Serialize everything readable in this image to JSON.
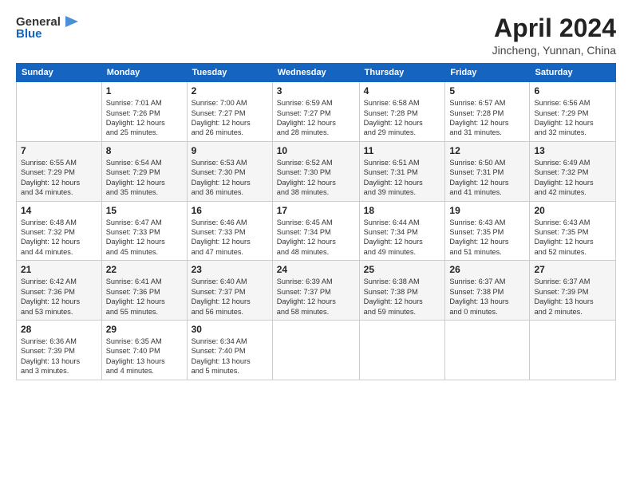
{
  "logo": {
    "general": "General",
    "blue": "Blue",
    "arrow": "▶"
  },
  "title": "April 2024",
  "subtitle": "Jincheng, Yunnan, China",
  "headers": [
    "Sunday",
    "Monday",
    "Tuesday",
    "Wednesday",
    "Thursday",
    "Friday",
    "Saturday"
  ],
  "weeks": [
    [
      {
        "day": "",
        "info": ""
      },
      {
        "day": "1",
        "info": "Sunrise: 7:01 AM\nSunset: 7:26 PM\nDaylight: 12 hours\nand 25 minutes."
      },
      {
        "day": "2",
        "info": "Sunrise: 7:00 AM\nSunset: 7:27 PM\nDaylight: 12 hours\nand 26 minutes."
      },
      {
        "day": "3",
        "info": "Sunrise: 6:59 AM\nSunset: 7:27 PM\nDaylight: 12 hours\nand 28 minutes."
      },
      {
        "day": "4",
        "info": "Sunrise: 6:58 AM\nSunset: 7:28 PM\nDaylight: 12 hours\nand 29 minutes."
      },
      {
        "day": "5",
        "info": "Sunrise: 6:57 AM\nSunset: 7:28 PM\nDaylight: 12 hours\nand 31 minutes."
      },
      {
        "day": "6",
        "info": "Sunrise: 6:56 AM\nSunset: 7:29 PM\nDaylight: 12 hours\nand 32 minutes."
      }
    ],
    [
      {
        "day": "7",
        "info": "Sunrise: 6:55 AM\nSunset: 7:29 PM\nDaylight: 12 hours\nand 34 minutes."
      },
      {
        "day": "8",
        "info": "Sunrise: 6:54 AM\nSunset: 7:29 PM\nDaylight: 12 hours\nand 35 minutes."
      },
      {
        "day": "9",
        "info": "Sunrise: 6:53 AM\nSunset: 7:30 PM\nDaylight: 12 hours\nand 36 minutes."
      },
      {
        "day": "10",
        "info": "Sunrise: 6:52 AM\nSunset: 7:30 PM\nDaylight: 12 hours\nand 38 minutes."
      },
      {
        "day": "11",
        "info": "Sunrise: 6:51 AM\nSunset: 7:31 PM\nDaylight: 12 hours\nand 39 minutes."
      },
      {
        "day": "12",
        "info": "Sunrise: 6:50 AM\nSunset: 7:31 PM\nDaylight: 12 hours\nand 41 minutes."
      },
      {
        "day": "13",
        "info": "Sunrise: 6:49 AM\nSunset: 7:32 PM\nDaylight: 12 hours\nand 42 minutes."
      }
    ],
    [
      {
        "day": "14",
        "info": "Sunrise: 6:48 AM\nSunset: 7:32 PM\nDaylight: 12 hours\nand 44 minutes."
      },
      {
        "day": "15",
        "info": "Sunrise: 6:47 AM\nSunset: 7:33 PM\nDaylight: 12 hours\nand 45 minutes."
      },
      {
        "day": "16",
        "info": "Sunrise: 6:46 AM\nSunset: 7:33 PM\nDaylight: 12 hours\nand 47 minutes."
      },
      {
        "day": "17",
        "info": "Sunrise: 6:45 AM\nSunset: 7:34 PM\nDaylight: 12 hours\nand 48 minutes."
      },
      {
        "day": "18",
        "info": "Sunrise: 6:44 AM\nSunset: 7:34 PM\nDaylight: 12 hours\nand 49 minutes."
      },
      {
        "day": "19",
        "info": "Sunrise: 6:43 AM\nSunset: 7:35 PM\nDaylight: 12 hours\nand 51 minutes."
      },
      {
        "day": "20",
        "info": "Sunrise: 6:43 AM\nSunset: 7:35 PM\nDaylight: 12 hours\nand 52 minutes."
      }
    ],
    [
      {
        "day": "21",
        "info": "Sunrise: 6:42 AM\nSunset: 7:36 PM\nDaylight: 12 hours\nand 53 minutes."
      },
      {
        "day": "22",
        "info": "Sunrise: 6:41 AM\nSunset: 7:36 PM\nDaylight: 12 hours\nand 55 minutes."
      },
      {
        "day": "23",
        "info": "Sunrise: 6:40 AM\nSunset: 7:37 PM\nDaylight: 12 hours\nand 56 minutes."
      },
      {
        "day": "24",
        "info": "Sunrise: 6:39 AM\nSunset: 7:37 PM\nDaylight: 12 hours\nand 58 minutes."
      },
      {
        "day": "25",
        "info": "Sunrise: 6:38 AM\nSunset: 7:38 PM\nDaylight: 12 hours\nand 59 minutes."
      },
      {
        "day": "26",
        "info": "Sunrise: 6:37 AM\nSunset: 7:38 PM\nDaylight: 13 hours\nand 0 minutes."
      },
      {
        "day": "27",
        "info": "Sunrise: 6:37 AM\nSunset: 7:39 PM\nDaylight: 13 hours\nand 2 minutes."
      }
    ],
    [
      {
        "day": "28",
        "info": "Sunrise: 6:36 AM\nSunset: 7:39 PM\nDaylight: 13 hours\nand 3 minutes."
      },
      {
        "day": "29",
        "info": "Sunrise: 6:35 AM\nSunset: 7:40 PM\nDaylight: 13 hours\nand 4 minutes."
      },
      {
        "day": "30",
        "info": "Sunrise: 6:34 AM\nSunset: 7:40 PM\nDaylight: 13 hours\nand 5 minutes."
      },
      {
        "day": "",
        "info": ""
      },
      {
        "day": "",
        "info": ""
      },
      {
        "day": "",
        "info": ""
      },
      {
        "day": "",
        "info": ""
      }
    ]
  ]
}
